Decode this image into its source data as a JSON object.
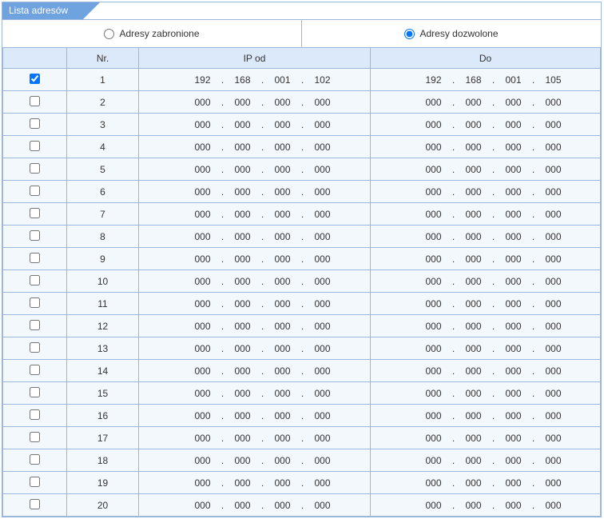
{
  "tab_label": "Lista adresów",
  "mode": {
    "forbidden_label": "Adresy zabronione",
    "allowed_label": "Adresy dozwolone",
    "selected": "allowed"
  },
  "headers": {
    "check": "",
    "nr": "Nr.",
    "ip_from": "IP od",
    "ip_to": "Do"
  },
  "rows": [
    {
      "checked": true,
      "nr": 1,
      "from": [
        "192",
        "168",
        "001",
        "102"
      ],
      "to": [
        "192",
        "168",
        "001",
        "105"
      ]
    },
    {
      "checked": false,
      "nr": 2,
      "from": [
        "000",
        "000",
        "000",
        "000"
      ],
      "to": [
        "000",
        "000",
        "000",
        "000"
      ]
    },
    {
      "checked": false,
      "nr": 3,
      "from": [
        "000",
        "000",
        "000",
        "000"
      ],
      "to": [
        "000",
        "000",
        "000",
        "000"
      ]
    },
    {
      "checked": false,
      "nr": 4,
      "from": [
        "000",
        "000",
        "000",
        "000"
      ],
      "to": [
        "000",
        "000",
        "000",
        "000"
      ]
    },
    {
      "checked": false,
      "nr": 5,
      "from": [
        "000",
        "000",
        "000",
        "000"
      ],
      "to": [
        "000",
        "000",
        "000",
        "000"
      ]
    },
    {
      "checked": false,
      "nr": 6,
      "from": [
        "000",
        "000",
        "000",
        "000"
      ],
      "to": [
        "000",
        "000",
        "000",
        "000"
      ]
    },
    {
      "checked": false,
      "nr": 7,
      "from": [
        "000",
        "000",
        "000",
        "000"
      ],
      "to": [
        "000",
        "000",
        "000",
        "000"
      ]
    },
    {
      "checked": false,
      "nr": 8,
      "from": [
        "000",
        "000",
        "000",
        "000"
      ],
      "to": [
        "000",
        "000",
        "000",
        "000"
      ]
    },
    {
      "checked": false,
      "nr": 9,
      "from": [
        "000",
        "000",
        "000",
        "000"
      ],
      "to": [
        "000",
        "000",
        "000",
        "000"
      ]
    },
    {
      "checked": false,
      "nr": 10,
      "from": [
        "000",
        "000",
        "000",
        "000"
      ],
      "to": [
        "000",
        "000",
        "000",
        "000"
      ]
    },
    {
      "checked": false,
      "nr": 11,
      "from": [
        "000",
        "000",
        "000",
        "000"
      ],
      "to": [
        "000",
        "000",
        "000",
        "000"
      ]
    },
    {
      "checked": false,
      "nr": 12,
      "from": [
        "000",
        "000",
        "000",
        "000"
      ],
      "to": [
        "000",
        "000",
        "000",
        "000"
      ]
    },
    {
      "checked": false,
      "nr": 13,
      "from": [
        "000",
        "000",
        "000",
        "000"
      ],
      "to": [
        "000",
        "000",
        "000",
        "000"
      ]
    },
    {
      "checked": false,
      "nr": 14,
      "from": [
        "000",
        "000",
        "000",
        "000"
      ],
      "to": [
        "000",
        "000",
        "000",
        "000"
      ]
    },
    {
      "checked": false,
      "nr": 15,
      "from": [
        "000",
        "000",
        "000",
        "000"
      ],
      "to": [
        "000",
        "000",
        "000",
        "000"
      ]
    },
    {
      "checked": false,
      "nr": 16,
      "from": [
        "000",
        "000",
        "000",
        "000"
      ],
      "to": [
        "000",
        "000",
        "000",
        "000"
      ]
    },
    {
      "checked": false,
      "nr": 17,
      "from": [
        "000",
        "000",
        "000",
        "000"
      ],
      "to": [
        "000",
        "000",
        "000",
        "000"
      ]
    },
    {
      "checked": false,
      "nr": 18,
      "from": [
        "000",
        "000",
        "000",
        "000"
      ],
      "to": [
        "000",
        "000",
        "000",
        "000"
      ]
    },
    {
      "checked": false,
      "nr": 19,
      "from": [
        "000",
        "000",
        "000",
        "000"
      ],
      "to": [
        "000",
        "000",
        "000",
        "000"
      ]
    },
    {
      "checked": false,
      "nr": 20,
      "from": [
        "000",
        "000",
        "000",
        "000"
      ],
      "to": [
        "000",
        "000",
        "000",
        "000"
      ]
    }
  ]
}
